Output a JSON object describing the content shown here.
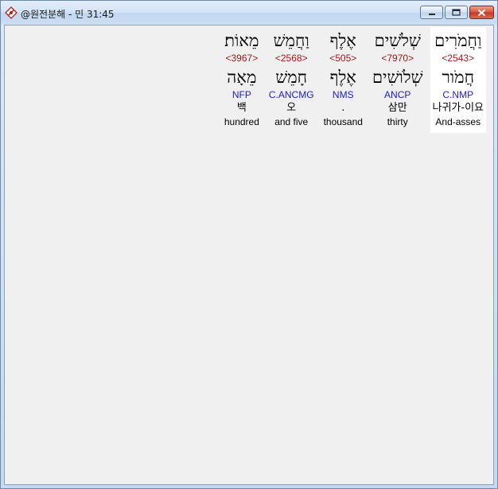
{
  "window": {
    "title": "@원전분해 - 민 31:45",
    "icons": {
      "app": "app-logo-icon",
      "minimize": "minimize-icon",
      "maximize": "maximize-icon",
      "close": "close-icon"
    }
  },
  "words": [
    {
      "hebrew": "וַחֲמֹרִים",
      "strong": "<2543>",
      "root": "חֲמֹור",
      "morph": "C.NMP",
      "korean": "나귀가-이요",
      "english": "And-asses"
    },
    {
      "hebrew": "שְׁלֹשִׁים",
      "strong": "<7970>",
      "root": "שְׁלֹושִׁים",
      "morph": "ANCP",
      "korean": "삼만",
      "english": "thirty"
    },
    {
      "hebrew": "אֶלֶף",
      "strong": "<505>",
      "root": "אֶלֶף",
      "morph": "NMS",
      "korean": ".",
      "english": "thousand"
    },
    {
      "hebrew": "וַחֲמֵשׁ",
      "strong": "<2568>",
      "root": "חָמֵשׁ",
      "morph": "C.ANCMG",
      "korean": "오",
      "english": "and five"
    },
    {
      "hebrew": "מֵאוֹת׃",
      "strong": "<3967>",
      "root": "מֵאָה",
      "morph": "NFP",
      "korean": "백",
      "english": "hundred"
    }
  ]
}
